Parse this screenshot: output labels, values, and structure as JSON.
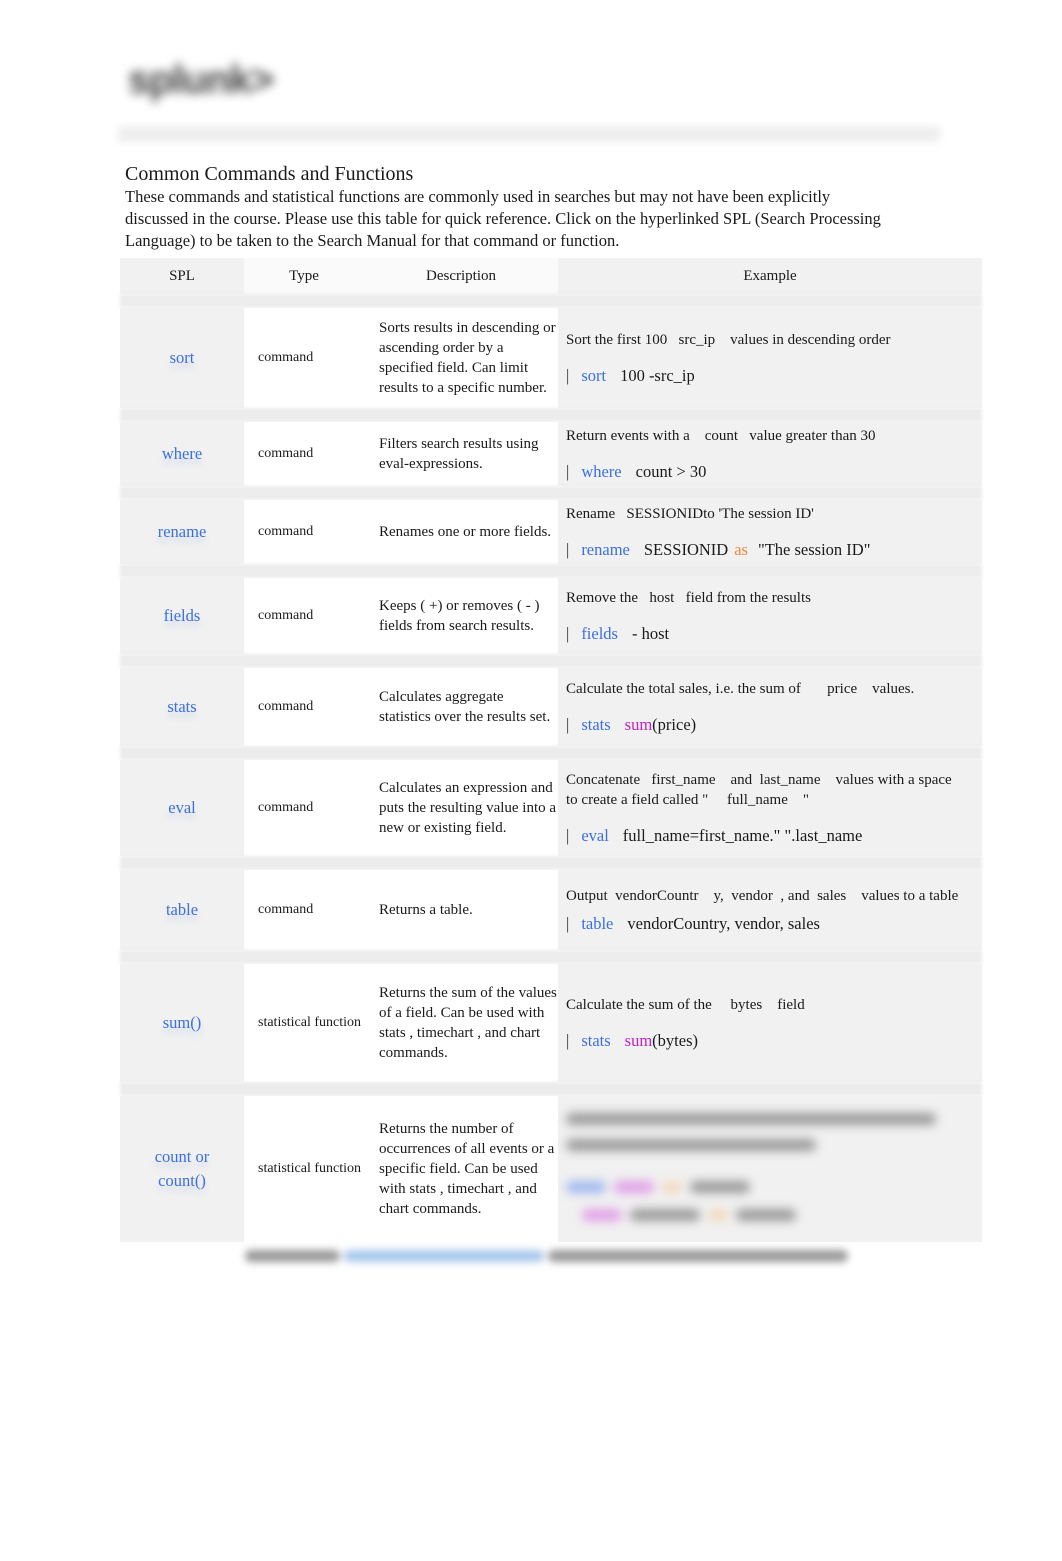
{
  "logo": {
    "text": "splunk>"
  },
  "title": "Common Commands and Functions",
  "intro": "These commands and statistical functions are commonly used in searches but may not have been explicitly discussed in the course. Please use this table for quick reference. Click on the hyperlinked SPL (Search Processing Language) to be taken to the Search Manual for that command or function.",
  "table": {
    "headers": {
      "spl": "SPL",
      "type": "Type",
      "description": "Description",
      "example": "Example"
    },
    "rows": [
      {
        "spl": "sort",
        "type": "command",
        "description": "Sorts results in descending or ascending order by a specified field. Can limit results to a specific number.",
        "example_text": "Sort the first 100   src_ip    values in descending order",
        "example_cmd": {
          "pipe": "|",
          "keyword": "sort",
          "rest": "100 -src_ip"
        }
      },
      {
        "spl": "where",
        "type": "command",
        "description": "Filters search results using eval-expressions.",
        "example_text": "Return events with a    count   value greater than 30",
        "example_cmd": {
          "pipe": "|",
          "keyword": "where",
          "rest": "count > 30"
        }
      },
      {
        "spl": "rename",
        "type": "command",
        "description": "Renames one or more fields.",
        "example_text": "Rename   SESSIONIDto 'The session ID'",
        "example_cmd": {
          "pipe": "|",
          "keyword": "rename",
          "arg": "SESSIONID",
          "operator": "as",
          "rest": "\"The session ID\""
        }
      },
      {
        "spl": "fields",
        "type": "command",
        "description": "Keeps ( +) or removes (  - ) fields from search results.",
        "example_text": "Remove the   host   field from the results",
        "example_cmd": {
          "pipe": "|",
          "keyword": "fields",
          "rest": "- host"
        }
      },
      {
        "spl": "stats",
        "type": "command",
        "description": "Calculates aggregate statistics over the results set.",
        "example_text": "Calculate the total sales, i.e. the sum of       price    values.",
        "example_cmd": {
          "pipe": "|",
          "keyword": "stats",
          "function": "sum",
          "rest": "(price)"
        }
      },
      {
        "spl": "eval",
        "type": "command",
        "description": "Calculates an expression and puts the resulting value into a new or existing field.",
        "example_text": "Concatenate   first_name    and  last_name    values with a space to create a field called \"     full_name    \"",
        "example_cmd": {
          "pipe": "|",
          "keyword": "eval",
          "rest": "full_name=first_name.\" \".last_name"
        }
      },
      {
        "spl": "table",
        "type": "command",
        "description": "Returns a table.",
        "example_text": "Output  vendorCountr    y,  vendor  , and  sales    values to a table",
        "example_cmd": {
          "pipe": "|",
          "keyword": "table",
          "rest": "vendorCountry, vendor, sales"
        }
      },
      {
        "spl": "sum()",
        "type": "statistical function",
        "description": "Returns the sum of the values of a field. Can be used with  stats    , timechart    , and  chart commands.",
        "example_text": "Calculate the sum of the     bytes    field",
        "example_cmd": {
          "pipe": "|",
          "keyword": "stats",
          "function": "sum",
          "rest": "(bytes)"
        }
      },
      {
        "spl": "count or count()",
        "type": "statistical function",
        "description": "Returns the number of occurrences of all events or a specific field. Can be used with   stats    , timechart    , and  chart commands.",
        "example_text": "",
        "example_cmd": null
      }
    ]
  },
  "colors": {
    "link": "#3b6fe0",
    "function": "#c020c8",
    "operator": "#e98a3a",
    "cell_grey": "#f1f1f1"
  }
}
